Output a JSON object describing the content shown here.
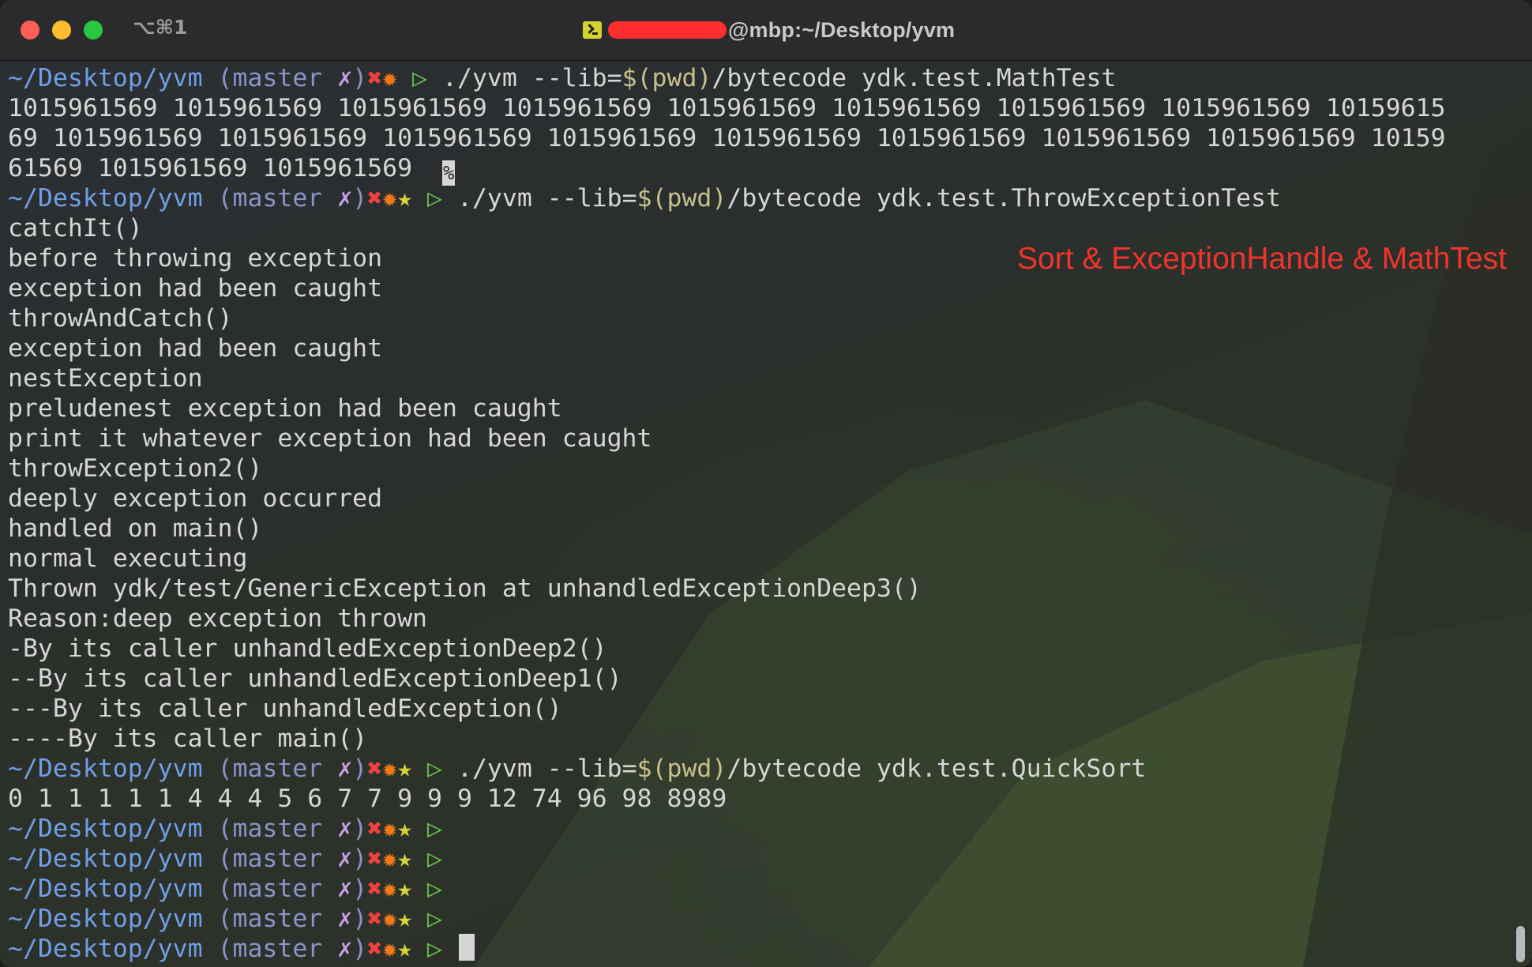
{
  "window": {
    "shortcut": "⌥⌘1",
    "title_suffix": "@mbp:~/Desktop/yvm",
    "terminal_icon": "terminal-icon"
  },
  "prompt": {
    "path": "~/Desktop/yvm",
    "branch_open": " (master ",
    "dirty_mark": "✗",
    "branch_close": ")",
    "status_x": "✖",
    "status_gear": "✹",
    "status_star": "★",
    "arrow": "▷"
  },
  "lines": [
    {
      "type": "prompt",
      "icons": 2,
      "cmd": {
        "pre": "./yvm --lib=",
        "sub": "$(pwd)",
        "post": "/bytecode ydk.test.MathTest"
      }
    },
    {
      "type": "out",
      "text": "1015961569 1015961569 1015961569 1015961569 1015961569 1015961569 1015961569 1015961569 10159615"
    },
    {
      "type": "out",
      "text": "69 1015961569 1015961569 1015961569 1015961569 1015961569 1015961569 1015961569 1015961569 10159"
    },
    {
      "type": "out",
      "text": "61569 1015961569 1015961569  ",
      "pct": "%"
    },
    {
      "type": "prompt",
      "icons": 3,
      "cmd": {
        "pre": "./yvm --lib=",
        "sub": "$(pwd)",
        "post": "/bytecode ydk.test.ThrowExceptionTest"
      }
    },
    {
      "type": "out",
      "text": "catchIt()"
    },
    {
      "type": "out",
      "text": "before throwing exception"
    },
    {
      "type": "out",
      "text": "exception had been caught"
    },
    {
      "type": "out",
      "text": "throwAndCatch()"
    },
    {
      "type": "out",
      "text": "exception had been caught"
    },
    {
      "type": "out",
      "text": "nestException"
    },
    {
      "type": "out",
      "text": "preludenest exception had been caught"
    },
    {
      "type": "out",
      "text": "print it whatever exception had been caught"
    },
    {
      "type": "out",
      "text": "throwException2()"
    },
    {
      "type": "out",
      "text": "deeply exception occurred"
    },
    {
      "type": "out",
      "text": "handled on main()"
    },
    {
      "type": "out",
      "text": "normal executing"
    },
    {
      "type": "out",
      "text": "Thrown ydk/test/GenericException at unhandledExceptionDeep3()"
    },
    {
      "type": "out",
      "text": "Reason:deep exception thrown"
    },
    {
      "type": "out",
      "text": "-By its caller unhandledExceptionDeep2()"
    },
    {
      "type": "out",
      "text": "--By its caller unhandledExceptionDeep1()"
    },
    {
      "type": "out",
      "text": "---By its caller unhandledException()"
    },
    {
      "type": "out",
      "text": "----By its caller main()"
    },
    {
      "type": "prompt",
      "icons": 3,
      "cmd": {
        "pre": "./yvm --lib=",
        "sub": "$(pwd)",
        "post": "/bytecode ydk.test.QuickSort"
      }
    },
    {
      "type": "out",
      "text": "0 1 1 1 1 1 4 4 4 5 6 7 7 9 9 9 12 74 96 98 8989"
    },
    {
      "type": "prompt",
      "icons": 3
    },
    {
      "type": "prompt",
      "icons": 3
    },
    {
      "type": "prompt",
      "icons": 3
    },
    {
      "type": "prompt",
      "icons": 3
    },
    {
      "type": "prompt",
      "icons": 3,
      "cursor": true
    }
  ],
  "annotation": "Sort & ExceptionHandle & MathTest"
}
